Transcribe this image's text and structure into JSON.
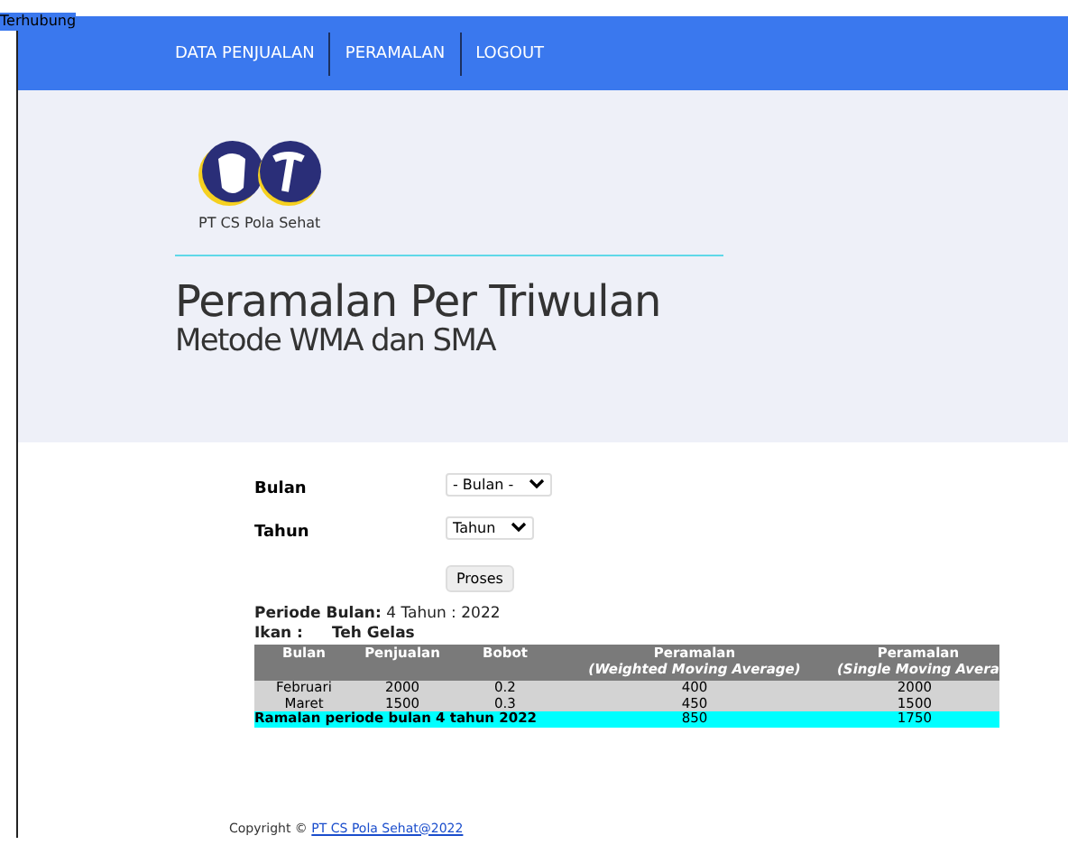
{
  "status": "Terhubung",
  "nav": [
    "DATA PENJUALAN",
    "PERAMALAN",
    "LOGOUT"
  ],
  "logo_caption": "PT CS Pola Sehat",
  "title": "Peramalan Per Triwulan",
  "subtitle": "Metode WMA dan SMA",
  "form": [
    {
      "label": "Bulan",
      "value": "- Bulan -"
    },
    {
      "label": "Tahun",
      "value": "Tahun"
    }
  ],
  "submit": "Proses",
  "periode": {
    "label": "Periode Bulan:",
    "value": "4 Tahun : 2022"
  },
  "ikan": {
    "label": "Ikan :",
    "value": "Teh Gelas"
  },
  "table": {
    "columns": [
      {
        "title": "Bulan"
      },
      {
        "title": "Penjualan"
      },
      {
        "title": "Bobot"
      },
      {
        "title": "Peramalan",
        "note": "(Weighted Moving Average)"
      },
      {
        "title": "Peramalan",
        "note": "(Single Moving Avera"
      }
    ],
    "rows": [
      [
        "Februari",
        "2000",
        "0.2",
        "400",
        "2000"
      ],
      [
        "Maret",
        "1500",
        "0.3",
        "450",
        "1500"
      ]
    ],
    "total": {
      "label": "Ramalan periode bulan 4 tahun 2022",
      "values": [
        "850",
        "1750"
      ]
    }
  },
  "footer": {
    "text": "Copyright ©",
    "link": "PT CS Pola Sehat@2022"
  }
}
